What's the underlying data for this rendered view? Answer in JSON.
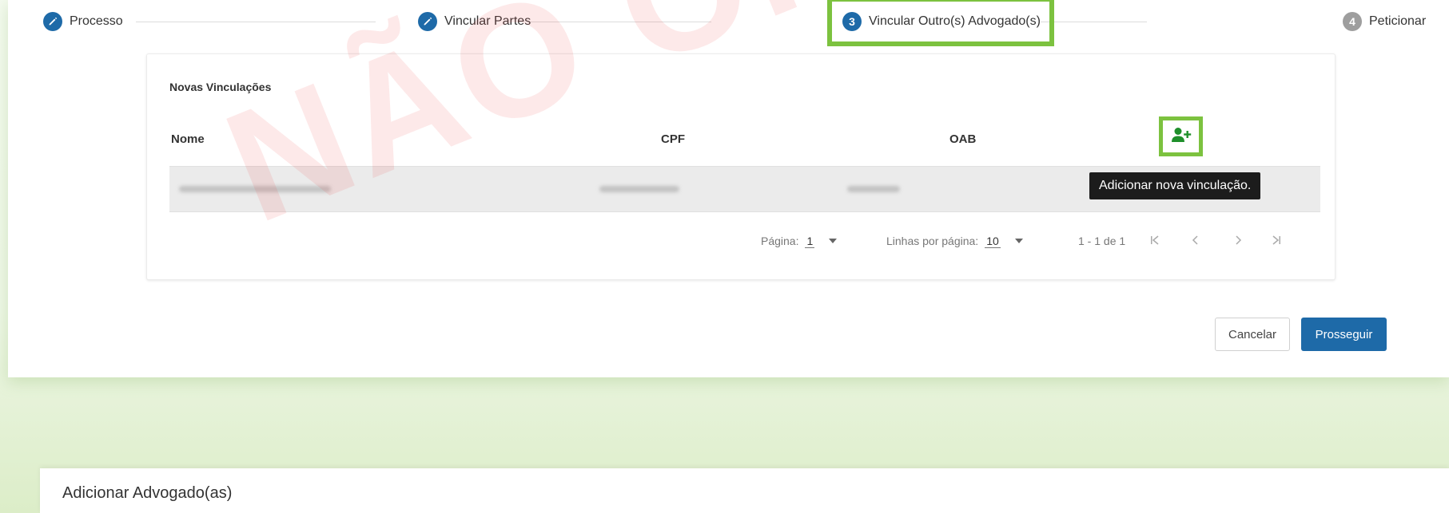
{
  "colors": {
    "primary": "#1e6aa8",
    "highlight": "#7cc23f",
    "add_icon": "#1f8f2b",
    "watermark": "#ec4646"
  },
  "stepper": {
    "steps": [
      {
        "label": "Processo",
        "state": "done",
        "icon": "pencil-icon"
      },
      {
        "label": "Vincular Partes",
        "state": "done",
        "icon": "pencil-icon"
      },
      {
        "label": "Vincular Outro(s) Advogado(s)",
        "state": "active",
        "number": "3"
      },
      {
        "label": "Peticionar",
        "state": "pending",
        "number": "4"
      }
    ]
  },
  "panel": {
    "title": "Novas Vinculações",
    "columns": [
      "Nome",
      "CPF",
      "OAB"
    ],
    "add_button_icon": "add-user-icon",
    "tooltip": "Adicionar nova vinculação.",
    "pagination": {
      "page_label": "Página:",
      "page_value": "1",
      "rows_label": "Linhas por página:",
      "rows_value": "10",
      "range": "1 - 1 de 1"
    }
  },
  "watermark": "NÃO OFICIAL",
  "actions": {
    "cancel": "Cancelar",
    "proceed": "Prosseguir"
  },
  "dialog": {
    "title": "Adicionar Advogado(as)"
  }
}
